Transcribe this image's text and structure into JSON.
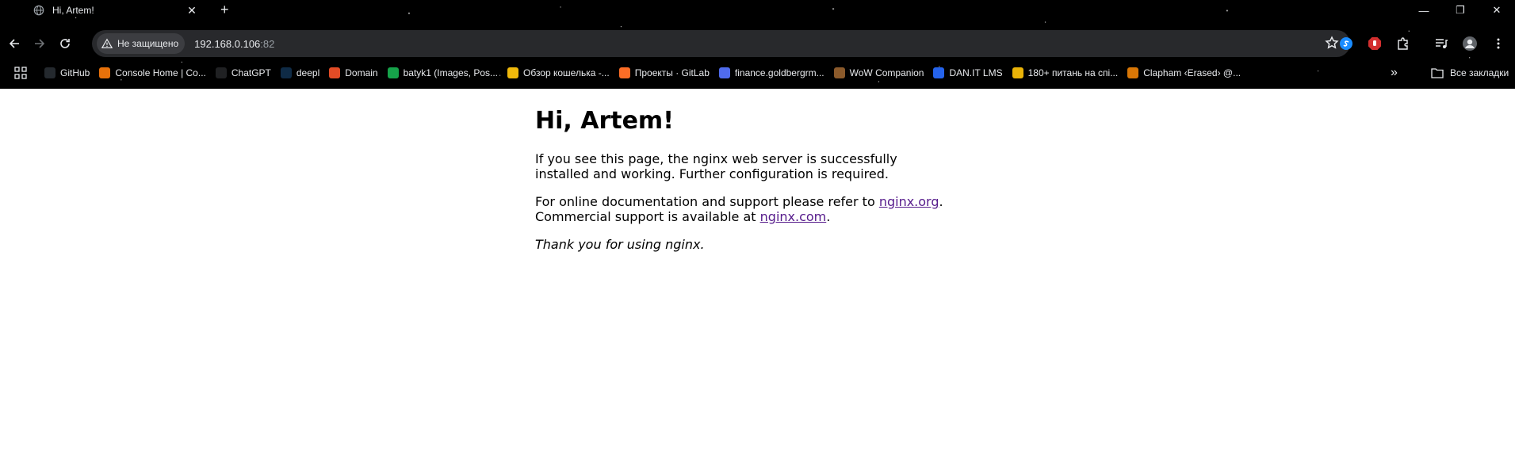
{
  "tab": {
    "title": "Hi, Artem!",
    "close_symbol": "✕",
    "new_tab_symbol": "+"
  },
  "window_controls": {
    "minimize": "—",
    "restore": "❐",
    "close": "✕"
  },
  "toolbar": {
    "security_label": "Не защищено",
    "url_host": "192.168.0.106",
    "url_port": ":82"
  },
  "bookmarks": [
    {
      "label": "GitHub",
      "icon": "github-icon",
      "color": "#24292e"
    },
    {
      "label": "Console Home | Co...",
      "icon": "aws-console-icon",
      "color": "#e8710a"
    },
    {
      "label": "ChatGPT",
      "icon": "chatgpt-icon",
      "color": "#202123"
    },
    {
      "label": "deepl",
      "icon": "deepl-icon",
      "color": "#0f2b46"
    },
    {
      "label": "Domain",
      "icon": "domain-icon",
      "color": "#e34c26"
    },
    {
      "label": "batyk1 (Images, Pos...",
      "icon": "batyk-icon",
      "color": "#16a34a"
    },
    {
      "label": "Обзор кошелька -...",
      "icon": "binance-icon",
      "color": "#f0b90b"
    },
    {
      "label": "Проекты · GitLab",
      "icon": "gitlab-icon",
      "color": "#fc6d26"
    },
    {
      "label": "finance.goldbergrm...",
      "icon": "finance-icon",
      "color": "#4f6bed"
    },
    {
      "label": "WoW Companion",
      "icon": "wow-icon",
      "color": "#8b5a2b"
    },
    {
      "label": "DAN.IT LMS",
      "icon": "danit-icon",
      "color": "#2563eb"
    },
    {
      "label": "180+ питань на спі...",
      "icon": "questions-icon",
      "color": "#eab308"
    },
    {
      "label": "Clapham ‹Erased› @...",
      "icon": "clapham-icon",
      "color": "#d97706"
    }
  ],
  "bookmarks_more": "»",
  "all_bookmarks": "Все закладки",
  "page": {
    "heading": "Hi, Artem!",
    "p1": "If you see this page, the nginx web server is successfully installed and working. Further configuration is required.",
    "p2_prefix": "For online documentation and support please refer to ",
    "link_org": "nginx.org",
    "p2_dot": ".",
    "p2_line2": "Commercial support is available at ",
    "link_com": "nginx.com",
    "p2_end": ".",
    "thanks": "Thank you for using nginx."
  },
  "colors": {
    "link": "#551a8b",
    "omnibox": "#28292c"
  }
}
